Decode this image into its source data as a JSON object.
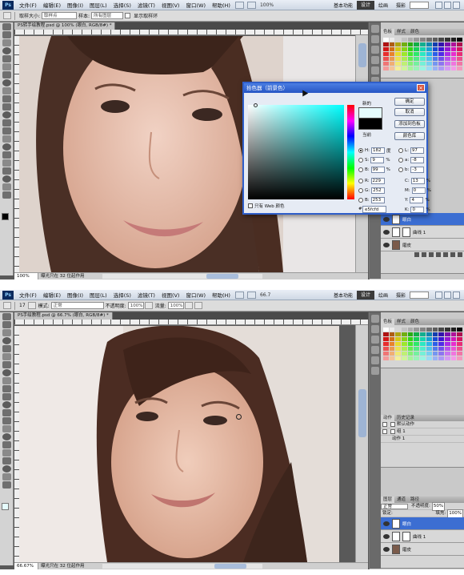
{
  "menu": {
    "items": [
      "文件(F)",
      "编辑(E)",
      "图像(I)",
      "图层(L)",
      "选择(S)",
      "滤镜(T)",
      "视图(V)",
      "窗口(W)",
      "帮助(H)"
    ],
    "top_zoom": "100%",
    "bottom_zoom": "66.7",
    "workspaces": [
      "基本功能",
      "设计",
      "绘画",
      "摄影"
    ],
    "active_workspace": "设计"
  },
  "top": {
    "options": {
      "sample_label": "取样大小:",
      "sample_value": "取样点",
      "sample_label2": "样本:",
      "sample_value2": "所有图层",
      "ring_label": "显示取样环"
    },
    "doc_tab": "PS转手绘教程.psd @ 100% (眼白, RGB/8#) *",
    "status_zoom": "100%",
    "status_text": "曝光只在 32 位起作用",
    "layers": [
      {
        "name": "眼白"
      },
      {
        "name": "曲线 1"
      },
      {
        "name": "磨皮"
      }
    ],
    "panel_tabs": [
      "色板",
      "样式",
      "颜色"
    ],
    "dialog": {
      "title": "拾色器（前景色）",
      "new_label": "新的",
      "current_label": "当前",
      "ok": "确定",
      "cancel": "取消",
      "add_swatch": "添加到色板",
      "color_libraries": "颜色库",
      "web_only": "只有 Web 颜色",
      "hsb": [
        {
          "label": "H:",
          "value": "182",
          "unit": "度"
        },
        {
          "label": "S:",
          "value": "9",
          "unit": "%"
        },
        {
          "label": "B:",
          "value": "99",
          "unit": "%"
        }
      ],
      "rgb": [
        {
          "label": "R:",
          "value": "229"
        },
        {
          "label": "G:",
          "value": "252"
        },
        {
          "label": "B:",
          "value": "253"
        }
      ],
      "lab": [
        {
          "label": "L:",
          "value": "97"
        },
        {
          "label": "a:",
          "value": "-8"
        },
        {
          "label": "b:",
          "value": "-3"
        }
      ],
      "cmyk": [
        {
          "label": "C:",
          "value": "13",
          "unit": "%"
        },
        {
          "label": "M:",
          "value": "0",
          "unit": "%"
        },
        {
          "label": "Y:",
          "value": "4",
          "unit": "%"
        },
        {
          "label": "K:",
          "value": "0",
          "unit": "%"
        }
      ],
      "hex_label": "#",
      "hex": "e5fcfd",
      "new_color": "#e5fcfd",
      "current_color": "#000000"
    }
  },
  "bottom": {
    "options": {
      "mode_label": "模式:",
      "mode_value": "正常",
      "opacity_label": "不透明度:",
      "opacity_value": "100%",
      "flow_label": "流量:",
      "flow_value": "100%",
      "brush_size": "17"
    },
    "doc_tab": "PS手绘教程.psd @ 66.7% (眼白, RGB/8#) *",
    "status_zoom": "66.67%",
    "status_text": "曝光只在 32 位起作用",
    "panel_tabs": [
      "色板",
      "样式",
      "颜色"
    ],
    "actions_tabs": [
      "动作",
      "历史记录"
    ],
    "actions": [
      "默认动作",
      "组 1",
      "动作 1"
    ],
    "layers_tabs": [
      "图层",
      "通道",
      "路径"
    ],
    "blend_mode": "正常",
    "opacity_label": "不透明度:",
    "opacity": "50%",
    "lock_label": "锁定:",
    "fill_label": "填充:",
    "fill": "100%",
    "layers": [
      {
        "name": "眼白"
      },
      {
        "name": "曲线 1"
      },
      {
        "name": "磨皮"
      }
    ]
  },
  "colors": {
    "selection": "#3c6ed2",
    "title_bar": "#2756c4"
  }
}
